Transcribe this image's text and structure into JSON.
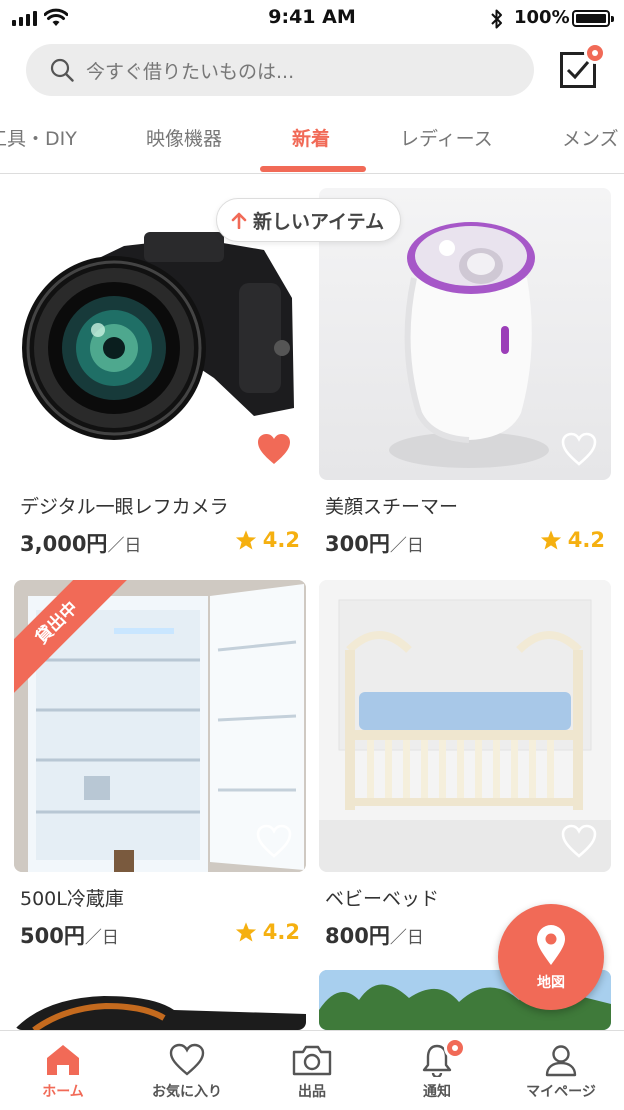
{
  "status_bar": {
    "time": "9:41 AM",
    "battery": "100%"
  },
  "search": {
    "placeholder": "今すぐ借りたいものは..."
  },
  "tabs": [
    {
      "label": "工具・DIY"
    },
    {
      "label": "映像機器"
    },
    {
      "label": "新着"
    },
    {
      "label": "レディース"
    },
    {
      "label": "メンズ"
    }
  ],
  "active_tab": "新着",
  "new_items_pill": "新しいアイテム",
  "unit": "／日",
  "items": [
    {
      "title": "デジタル一眼レフカメラ",
      "price": "3,000円",
      "rating": "4.2",
      "favorited": true,
      "image": "camera"
    },
    {
      "title": "美顔スチーマー",
      "price": "300円",
      "rating": "4.2",
      "favorited": false,
      "image": "facial-steamer"
    },
    {
      "title": "500L冷蔵庫",
      "price": "500円",
      "rating": "4.2",
      "favorited": false,
      "image": "refrigerator",
      "badge": "貸出中"
    },
    {
      "title": "ベビーベッド",
      "price": "800円",
      "favorited": false,
      "image": "baby-crib"
    }
  ],
  "map_button": {
    "label": "地図"
  },
  "bottom_nav": [
    {
      "label": "ホーム",
      "icon": "home-icon",
      "active": true
    },
    {
      "label": "お気に入り",
      "icon": "heart-icon"
    },
    {
      "label": "出品",
      "icon": "camera-icon"
    },
    {
      "label": "通知",
      "icon": "bell-icon"
    },
    {
      "label": "マイページ",
      "icon": "person-icon"
    }
  ],
  "colors": {
    "accent": "#f16a57",
    "star": "#f5b010"
  }
}
